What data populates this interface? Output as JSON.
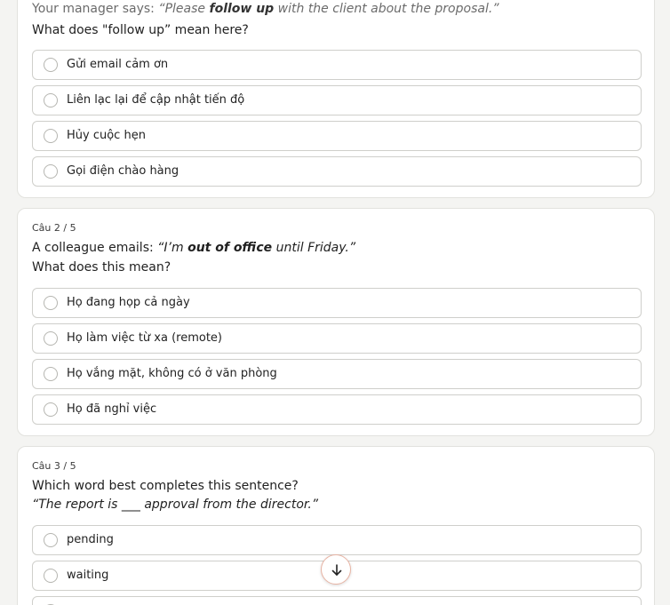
{
  "q1": {
    "prompt_prefix": "Your manager says: ",
    "prompt_quote_a": "“Please ",
    "prompt_quote_bold": "follow up",
    "prompt_quote_b": " with the client about the proposal.”",
    "question": "What does \"follow up” mean here?",
    "options": [
      "Gửi email cảm ơn",
      "Liên lạc lại để cập nhật tiến độ",
      "Hủy cuộc hẹn",
      "Gọi điện chào hàng"
    ]
  },
  "q2": {
    "number": "Câu 2 / 5",
    "prompt_prefix": "A colleague emails: ",
    "prompt_quote_a": "“I’m ",
    "prompt_quote_bold": "out of office",
    "prompt_quote_b": " until Friday.”",
    "question": "What does this mean?",
    "options": [
      "Họ đang họp cả ngày",
      "Họ làm việc từ xa (remote)",
      "Họ vắng mặt, không có ở văn phòng",
      "Họ đã nghỉ việc"
    ]
  },
  "q3": {
    "number": "Câu 3 / 5",
    "question": "Which word best completes this sentence?",
    "sentence": "“The report is ___ approval from the director.”",
    "options": [
      "pending",
      "waiting"
    ]
  },
  "scroll_down": {
    "icon": "arrow-down-icon",
    "accent": "#e8b4a4"
  }
}
